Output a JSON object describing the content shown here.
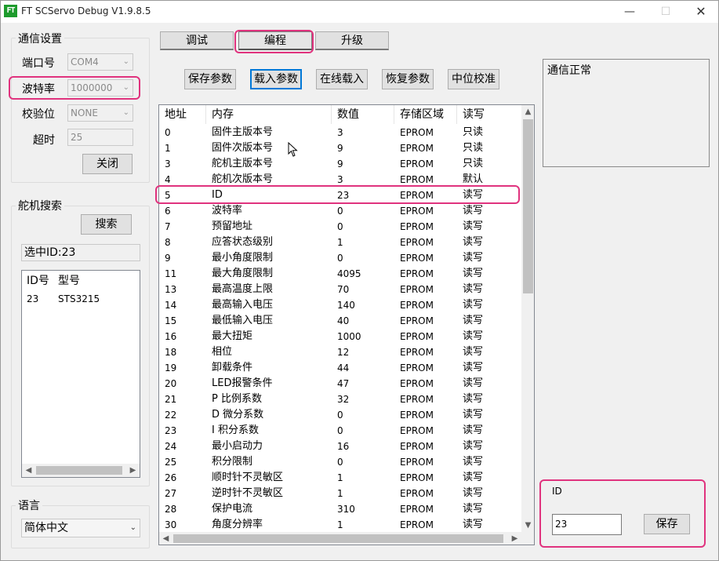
{
  "window": {
    "logo": "FT",
    "title": "FT SCServo Debug V1.9.8.5",
    "minimize": "—",
    "maximize": "☐",
    "close": "✕"
  },
  "comm": {
    "group_title": "通信设置",
    "port_label": "端口号",
    "port_value": "COM4",
    "baud_label": "波特率",
    "baud_value": "1000000",
    "parity_label": "校验位",
    "parity_value": "NONE",
    "timeout_label": "超时",
    "timeout_value": "25",
    "close_button": "关闭"
  },
  "search": {
    "group_title": "舵机搜索",
    "search_button": "搜索",
    "selected": "选中ID:23",
    "columns": [
      "ID号",
      "型号"
    ],
    "rows": [
      [
        "23",
        "STS3215"
      ]
    ]
  },
  "language": {
    "group_title": "语言",
    "value": "简体中文"
  },
  "tabs": [
    "调试",
    "编程",
    "升级"
  ],
  "actions": [
    "保存参数",
    "载入参数",
    "在线载入",
    "恢复参数",
    "中位校准"
  ],
  "status_text": "通信正常",
  "table": {
    "columns": [
      "地址",
      "内存",
      "数值",
      "存储区域",
      "读写"
    ],
    "rows": [
      [
        "0",
        "固件主版本号",
        "3",
        "EPROM",
        "只读"
      ],
      [
        "1",
        "固件次版本号",
        "9",
        "EPROM",
        "只读"
      ],
      [
        "3",
        "舵机主版本号",
        "9",
        "EPROM",
        "只读"
      ],
      [
        "4",
        "舵机次版本号",
        "3",
        "EPROM",
        "默认"
      ],
      [
        "5",
        "ID",
        "23",
        "EPROM",
        "读写"
      ],
      [
        "6",
        "波特率",
        "0",
        "EPROM",
        "读写"
      ],
      [
        "7",
        "预留地址",
        "0",
        "EPROM",
        "读写"
      ],
      [
        "8",
        "应答状态级别",
        "1",
        "EPROM",
        "读写"
      ],
      [
        "9",
        "最小角度限制",
        "0",
        "EPROM",
        "读写"
      ],
      [
        "11",
        "最大角度限制",
        "4095",
        "EPROM",
        "读写"
      ],
      [
        "13",
        "最高温度上限",
        "70",
        "EPROM",
        "读写"
      ],
      [
        "14",
        "最高输入电压",
        "140",
        "EPROM",
        "读写"
      ],
      [
        "15",
        "最低输入电压",
        "40",
        "EPROM",
        "读写"
      ],
      [
        "16",
        "最大扭矩",
        "1000",
        "EPROM",
        "读写"
      ],
      [
        "18",
        "相位",
        "12",
        "EPROM",
        "读写"
      ],
      [
        "19",
        "卸载条件",
        "44",
        "EPROM",
        "读写"
      ],
      [
        "20",
        "LED报警条件",
        "47",
        "EPROM",
        "读写"
      ],
      [
        "21",
        "P 比例系数",
        "32",
        "EPROM",
        "读写"
      ],
      [
        "22",
        "D 微分系数",
        "0",
        "EPROM",
        "读写"
      ],
      [
        "23",
        "I 积分系数",
        "0",
        "EPROM",
        "读写"
      ],
      [
        "24",
        "最小启动力",
        "16",
        "EPROM",
        "读写"
      ],
      [
        "25",
        "积分限制",
        "0",
        "EPROM",
        "读写"
      ],
      [
        "26",
        "顺时针不灵敏区",
        "1",
        "EPROM",
        "读写"
      ],
      [
        "27",
        "逆时针不灵敏区",
        "1",
        "EPROM",
        "读写"
      ],
      [
        "28",
        "保护电流",
        "310",
        "EPROM",
        "读写"
      ],
      [
        "30",
        "角度分辨率",
        "1",
        "EPROM",
        "读写"
      ]
    ]
  },
  "edit": {
    "label": "ID",
    "value": "23",
    "save_button": "保存"
  },
  "colors": {
    "highlight": "#e0337e",
    "focus": "#0078d7",
    "logo_green": "#1d9b2c"
  }
}
